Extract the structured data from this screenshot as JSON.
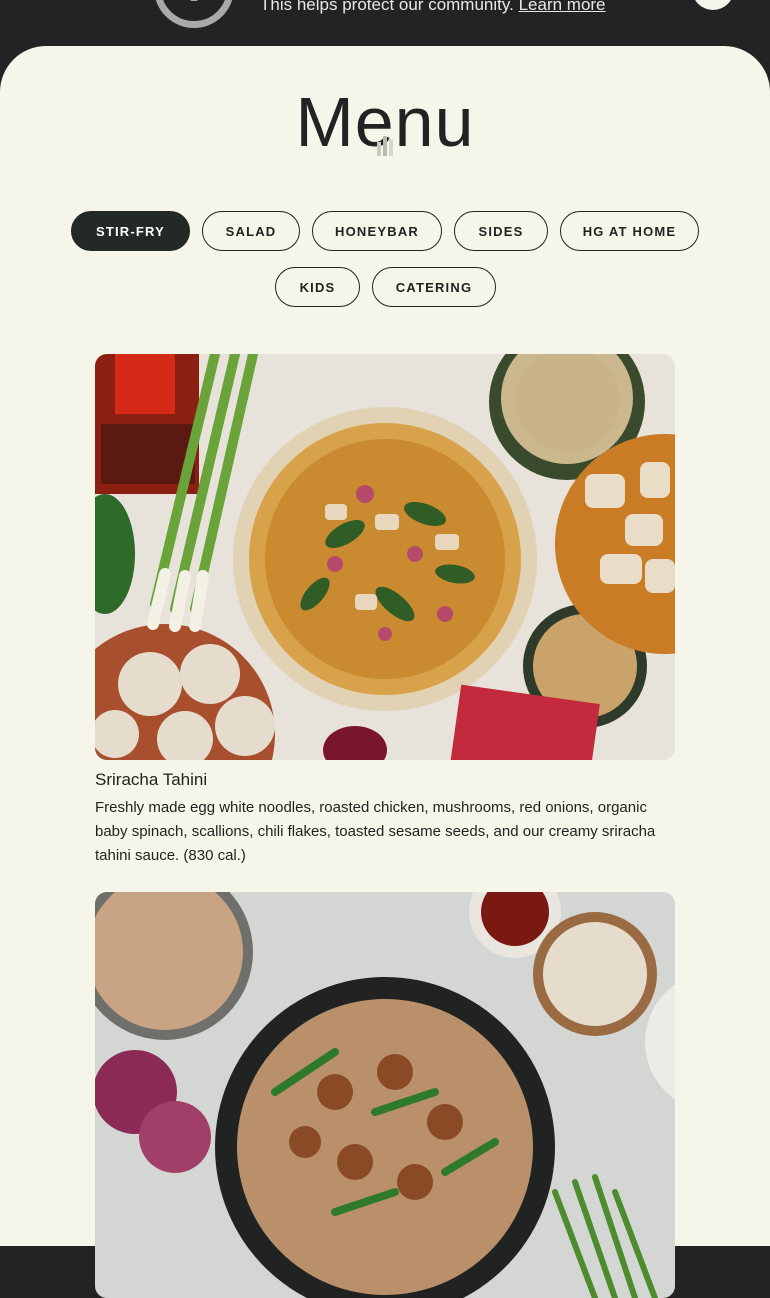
{
  "banner": {
    "text": "This helps protect our community.",
    "link": "Learn more"
  },
  "page": {
    "title": "Menu"
  },
  "categories": [
    {
      "label": "STIR-FRY",
      "active": true
    },
    {
      "label": "SALAD",
      "active": false
    },
    {
      "label": "HONEYBAR",
      "active": false
    },
    {
      "label": "SIDES",
      "active": false
    },
    {
      "label": "HG AT HOME",
      "active": false
    },
    {
      "label": "KIDS",
      "active": false
    },
    {
      "label": "CATERING",
      "active": false
    }
  ],
  "items": [
    {
      "name": "Sriracha Tahini",
      "description": "Freshly made egg white noodles, roasted chicken, mushrooms, red onions, organic baby spinach, scallions, chili flakes, toasted sesame seeds, and our creamy sriracha tahini sauce. (830 cal.)"
    }
  ],
  "colors": {
    "banner_bg": "#232323",
    "page_bg": "#f6f5ea",
    "active_chip": "#232927",
    "text": "#222222"
  }
}
